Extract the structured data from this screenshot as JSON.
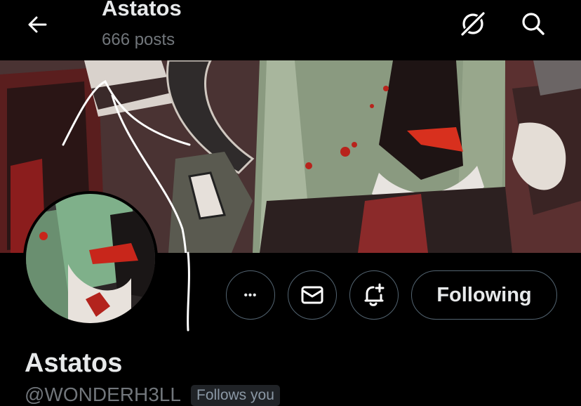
{
  "header": {
    "title": "Astatos",
    "post_count": "666 posts"
  },
  "profile": {
    "display_name": "Astatos",
    "handle": "@WONDERH3LL",
    "follows_badge": "Follows you"
  },
  "actions": {
    "more_label": "•••",
    "following_label": "Following"
  },
  "icons": {
    "back": "arrow-left-icon",
    "grok": "grok-icon",
    "search": "search-icon",
    "more": "more-icon",
    "message": "envelope-icon",
    "notify": "bell-plus-icon"
  },
  "colors": {
    "background": "#000000",
    "text": "#e7e9ea",
    "secondary_text": "#71767b",
    "button_border": "#536471",
    "badge_bg": "#202327"
  }
}
